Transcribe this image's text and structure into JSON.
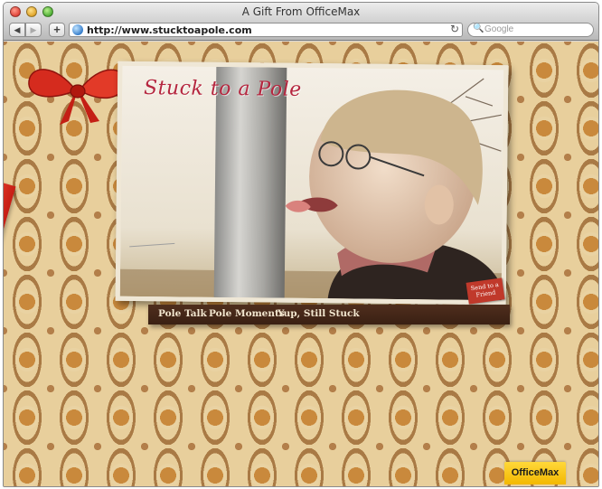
{
  "window": {
    "title": "A Gift From OfficeMax"
  },
  "toolbar": {
    "back_glyph": "◀",
    "forward_glyph": "▶",
    "add_glyph": "+",
    "url": "http://www.stucktoapole.com",
    "reload_glyph": "↻",
    "search_placeholder": "Google",
    "search_glyph": "🔍"
  },
  "page": {
    "title": "Stuck to a Pole",
    "send_to_friend": "Send to a Friend",
    "nav": [
      "Pole Talk",
      "Pole Moments",
      "Yup, Still Stuck"
    ],
    "logo": "OfficeMax"
  },
  "colors": {
    "wallpaper": "#e8cf9c",
    "ribbon": "#e8402d",
    "nav_strip": "#4f2e1d",
    "logo_bg": "#ffd83a",
    "title_script": "#b5263f"
  }
}
